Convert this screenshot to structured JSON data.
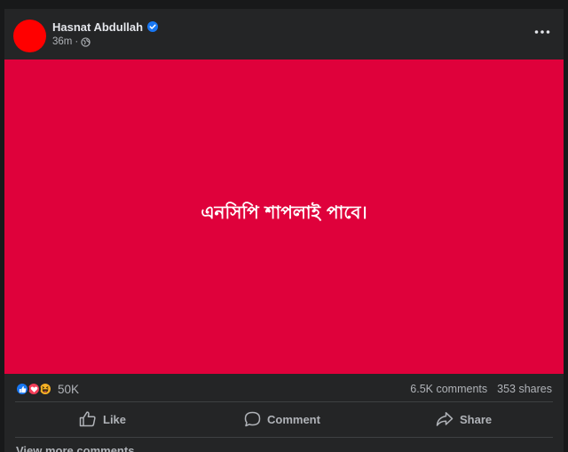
{
  "post": {
    "author": "Hasnat Abdullah",
    "verified_icon": "verified-badge-icon",
    "timestamp": "36m",
    "separator": "·",
    "audience_icon": "globe-icon",
    "more_icon": "more-options-icon",
    "avatar_color": "#ff0000",
    "image_background": "#df013b",
    "image_text": "এনসিপি শাপলাই পাবে।"
  },
  "engagement": {
    "reaction_icons": [
      "like-icon",
      "love-icon",
      "haha-icon"
    ],
    "reaction_count": "50K",
    "comments": "6.5K comments",
    "shares": "353 shares"
  },
  "actions": {
    "like_label": "Like",
    "comment_label": "Comment",
    "share_label": "Share"
  },
  "footer": {
    "view_more": "View more comments"
  },
  "colors": {
    "page_background": "#18191a",
    "card_background": "#242526",
    "accent": "#1877f2",
    "secondary_text": "#b0b3b8"
  }
}
